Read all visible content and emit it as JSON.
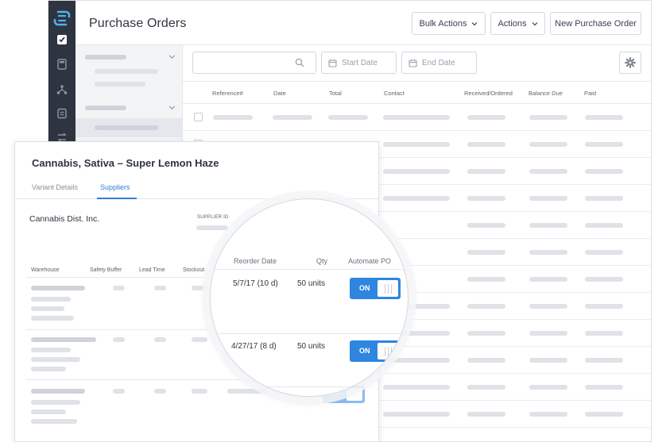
{
  "app": {
    "page_title": "Purchase Orders",
    "buttons": {
      "bulk_actions": "Bulk Actions",
      "actions": "Actions",
      "new_po": "New Purchase Order"
    },
    "filters": {
      "search_placeholder": "",
      "start_date": "Start Date",
      "end_date": "End Date"
    },
    "table_headers": [
      "Reference#",
      "Date",
      "Total",
      "Contact",
      "Received/Ordered",
      "Balance Due",
      "Paid"
    ]
  },
  "card": {
    "title": "Cannabis, Sativa – Super Lemon Haze",
    "tabs": [
      "Variant Details",
      "Suppliers"
    ],
    "active_tab": "Suppliers",
    "supplier_name": "Cannabis Dist. Inc.",
    "supplier_id_label": "SUPPLIER ID",
    "columns": [
      "Warehouse",
      "Safety Buffer",
      "Lead Time",
      "Stockout"
    ],
    "faint_toggle": "ON"
  },
  "lens": {
    "headers": [
      "Reorder Date",
      "Qty",
      "Automate PO"
    ],
    "rows": [
      {
        "reorder_date": "5/7/17 (10 d)",
        "qty": "50 units",
        "automate": "ON"
      },
      {
        "reorder_date": "4/27/17 (8 d)",
        "qty": "50 units",
        "automate": "ON"
      }
    ]
  },
  "colors": {
    "accent": "#2f86e0",
    "rail": "#2e3440",
    "logo": "#4fb3e8"
  },
  "icons": [
    "logo-icon",
    "checklist-icon",
    "calculator-icon",
    "network-icon",
    "document-icon",
    "transfer-icon",
    "search-icon",
    "calendar-icon",
    "gear-icon",
    "chevron-down-icon"
  ]
}
